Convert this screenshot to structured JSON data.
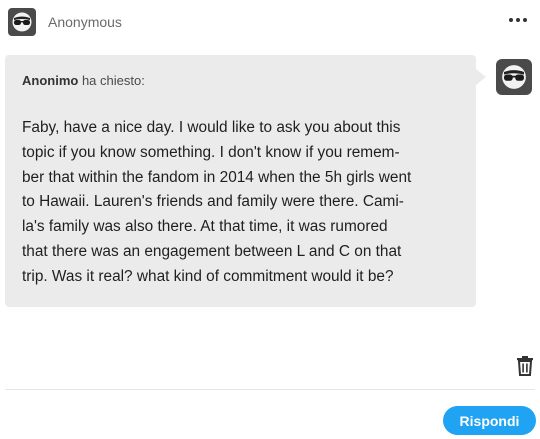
{
  "post": {
    "author": "Anonymous",
    "more_icon": "more-horizontal-icon"
  },
  "ask": {
    "asker_name": "Anonimo",
    "asked_suffix": " ha chiesto:",
    "question": "Faby, have a nice day.  I would like to ask you about this\ntopic if you know something.  I don't know if you remem-\nber that within the fandom in 2014 when the 5h girls went\nto Hawaii.  Lauren's friends and family were there.  Cami-\nla's family was also there.  At that time, it was rumored\nthat there was an engagement between L and C on that\ntrip. Was it real?  what kind of commitment would it be?",
    "avatar_icon": "anonymous-sunglasses-avatar"
  },
  "actions": {
    "delete_icon": "trash-icon",
    "reply_label": "Rispondi"
  },
  "colors": {
    "bubble": "#ebebeb",
    "reply_button": "#1fa3f2",
    "avatar": "#4a4a4a"
  }
}
